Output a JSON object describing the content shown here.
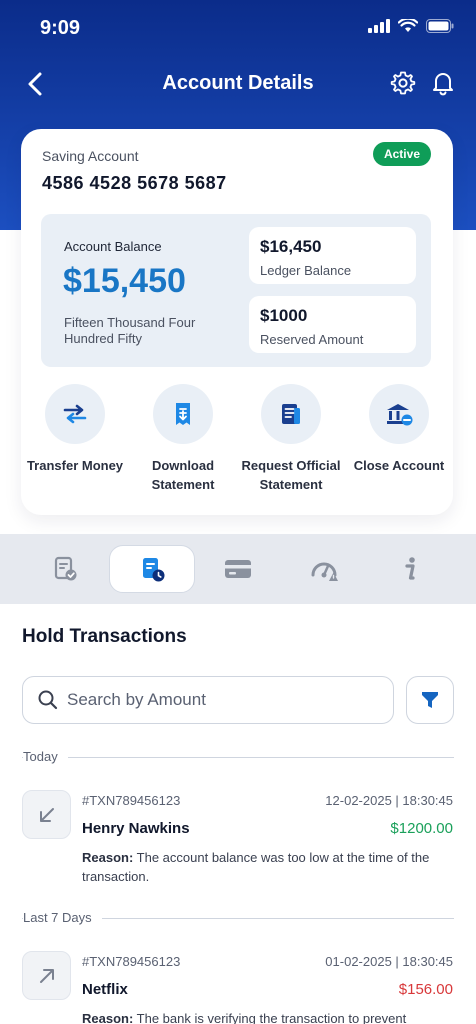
{
  "status_bar": {
    "time": "9:09"
  },
  "nav": {
    "title": "Account Details"
  },
  "account": {
    "type": "Saving Account",
    "status": "Active",
    "number": "4586 4528 5678 5687",
    "balance_label": "Account Balance",
    "balance": "$15,450",
    "balance_words": "Fifteen Thousand Four Hundred Fifty",
    "ledger_value": "$16,450",
    "ledger_label": "Ledger Balance",
    "reserved_value": "$1000",
    "reserved_label": "Reserved Amount"
  },
  "actions": [
    {
      "label": "Transfer Money",
      "icon": "transfer-icon"
    },
    {
      "label": "Download Statement",
      "icon": "download-statement-icon"
    },
    {
      "label": "Request Official Statement",
      "icon": "request-statement-icon"
    },
    {
      "label": "Close Account",
      "icon": "close-account-icon"
    }
  ],
  "tabs": [
    {
      "icon": "statement-check-icon",
      "active": false
    },
    {
      "icon": "hold-transactions-icon",
      "active": true
    },
    {
      "icon": "card-icon",
      "active": false
    },
    {
      "icon": "limits-icon",
      "active": false
    },
    {
      "icon": "info-icon",
      "active": false
    }
  ],
  "section": {
    "title": "Hold Transactions"
  },
  "search": {
    "placeholder": "Search by Amount"
  },
  "groups": {
    "today": "Today",
    "last7": "Last 7 Days"
  },
  "transactions": [
    {
      "id": "#TXN789456123",
      "date": "12-02-2025 | 18:30:45",
      "name": "Henry Nawkins",
      "amount": "$1200.00",
      "amount_color": "#1aa05a",
      "reason_label": "Reason:",
      "reason": " The account balance was too low at the time of the transaction.",
      "direction": "incoming"
    },
    {
      "id": "#TXN789456123",
      "date": "01-02-2025 | 18:30:45",
      "name": "Netflix",
      "amount": "$156.00",
      "amount_color": "#d8383a",
      "reason_label": "Reason:",
      "reason": " The bank is verifying the transaction to prevent",
      "direction": "outgoing"
    }
  ],
  "colors": {
    "primary": "#1976c5",
    "header_dark": "#0b2c8a",
    "success": "#0f9d58"
  }
}
